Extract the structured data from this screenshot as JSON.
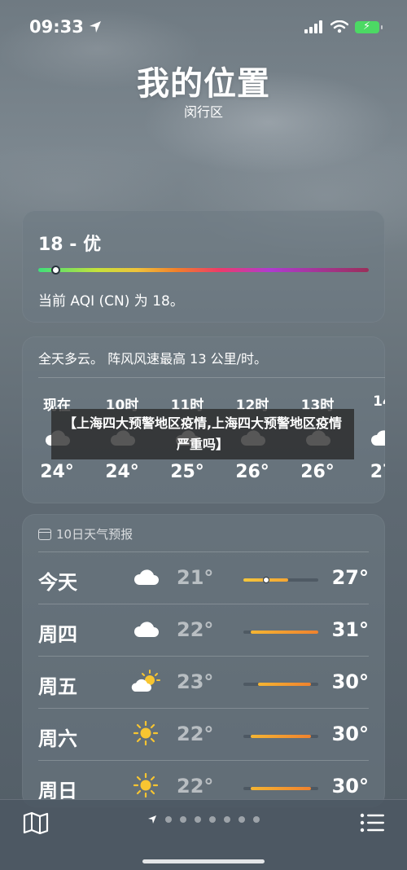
{
  "status_bar": {
    "time": "09:33",
    "battery_color": "#4cd964"
  },
  "header": {
    "city": "我的位置",
    "district": "闵行区"
  },
  "aqi": {
    "value_label": "18 - 优",
    "level_fraction": 0.04,
    "description": "当前 AQI (CN) 为 18。"
  },
  "hourly": {
    "summary": "全天多云。 阵风风速最高 13 公里/时。",
    "hours": [
      {
        "label": "现在",
        "icon": "cloud-icon",
        "temp": "24°"
      },
      {
        "label": "10时",
        "icon": "cloud-icon",
        "temp": "24°"
      },
      {
        "label": "11时",
        "icon": "cloud-icon",
        "temp": "25°"
      },
      {
        "label": "12时",
        "icon": "cloud-icon",
        "temp": "26°"
      },
      {
        "label": "13时",
        "icon": "cloud-icon",
        "temp": "26°"
      },
      {
        "label": "14",
        "icon": "cloud-icon",
        "temp": "27"
      }
    ]
  },
  "banner": {
    "text": "【上海四大预警地区疫情,上海四大预警地区疫情严重吗】"
  },
  "daily": {
    "header": "10日天气预报",
    "range_min": 21,
    "range_max": 31,
    "days": [
      {
        "day": "今天",
        "icon": "cloud-icon",
        "low_text": "21°",
        "high_text": "27°",
        "low": 21,
        "high": 27,
        "current": 24
      },
      {
        "day": "周四",
        "icon": "cloud-icon",
        "low_text": "22°",
        "high_text": "31°",
        "low": 22,
        "high": 31
      },
      {
        "day": "周五",
        "icon": "partly-sunny-icon",
        "low_text": "23°",
        "high_text": "30°",
        "low": 23,
        "high": 30
      },
      {
        "day": "周六",
        "icon": "sun-icon",
        "low_text": "22°",
        "high_text": "30°",
        "low": 22,
        "high": 30
      },
      {
        "day": "周日",
        "icon": "sun-icon",
        "low_text": "22°",
        "high_text": "30°",
        "low": 22,
        "high": 30
      }
    ]
  },
  "toolbar": {
    "page_count": 8,
    "current_page": 0
  }
}
